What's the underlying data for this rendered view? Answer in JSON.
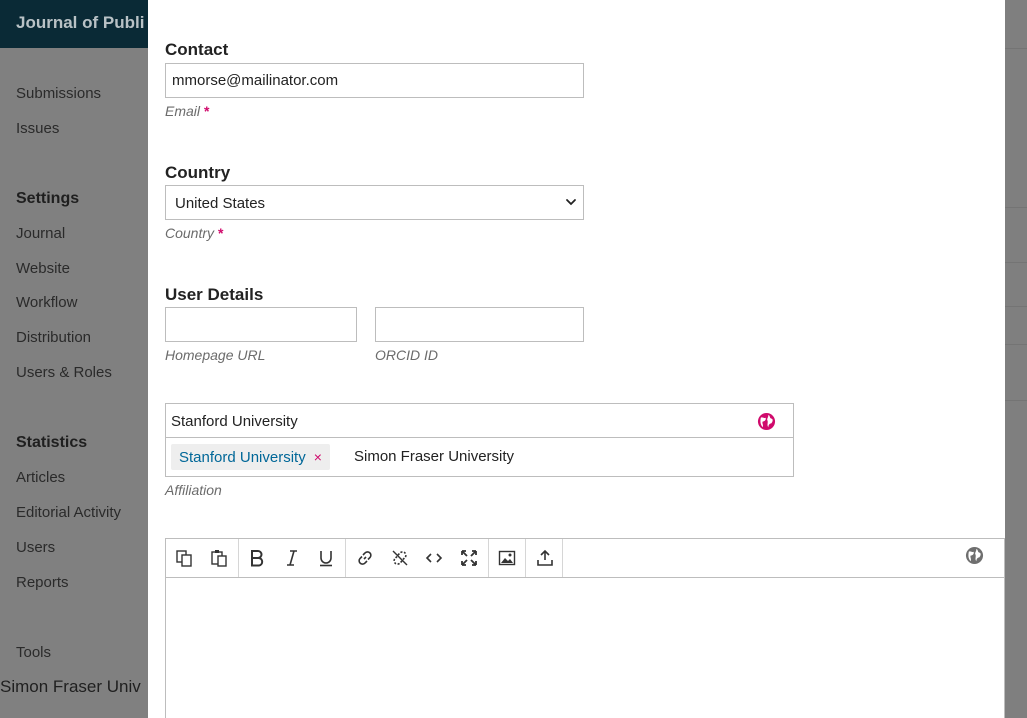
{
  "app": {
    "journal_title": "Journal of Publi"
  },
  "sidebar": {
    "items": [
      {
        "label": "Submissions"
      },
      {
        "label": "Issues"
      }
    ],
    "settings_heading": "Settings",
    "settings_items": [
      {
        "label": "Journal"
      },
      {
        "label": "Website"
      },
      {
        "label": "Workflow"
      },
      {
        "label": "Distribution"
      },
      {
        "label": "Users & Roles"
      }
    ],
    "statistics_heading": "Statistics",
    "statistics_items": [
      {
        "label": "Articles"
      },
      {
        "label": "Editorial Activity"
      },
      {
        "label": "Users"
      },
      {
        "label": "Reports"
      }
    ],
    "tools_label": "Tools",
    "footer_text": "Simon Fraser Univ"
  },
  "form": {
    "contact": {
      "heading": "Contact",
      "email_value": "mmorse@mailinator.com",
      "email_label": "Email",
      "required_mark": "*"
    },
    "country": {
      "heading": "Country",
      "selected": "United States",
      "label": "Country",
      "required_mark": "*"
    },
    "user_details": {
      "heading": "User Details",
      "homepage_value": "",
      "homepage_label": "Homepage URL",
      "orcid_value": "",
      "orcid_label": "ORCID ID"
    },
    "affiliation": {
      "input_value": "Stanford University",
      "tags": [
        {
          "label": "Stanford University",
          "remove": "×"
        }
      ],
      "typed_text": "Simon Fraser University",
      "label": "Affiliation"
    },
    "editor": {
      "content": ""
    }
  },
  "colors": {
    "accent_pink": "#d00a6c",
    "link_blue": "#006798",
    "header_dark": "#0a2a36"
  }
}
